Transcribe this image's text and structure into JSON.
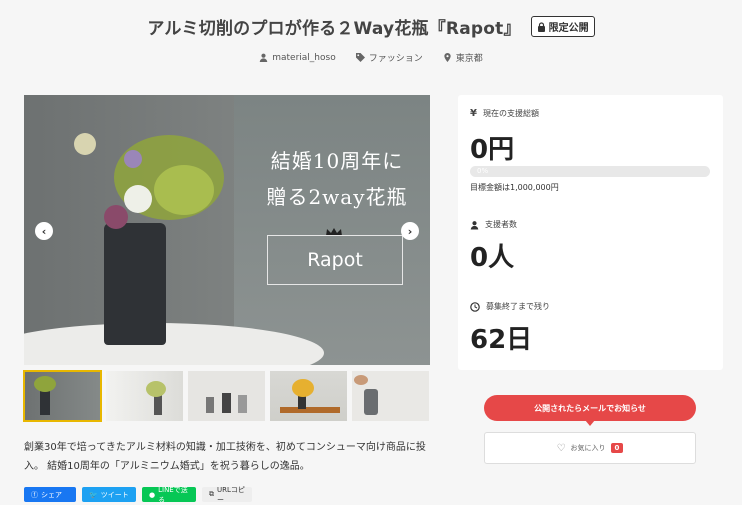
{
  "header": {
    "title": "アルミ切削のプロが作る２Way花瓶『Rapot』",
    "badge": "限定公開"
  },
  "meta": {
    "author": "material_hoso",
    "category": "ファッション",
    "location": "東京都"
  },
  "hero": {
    "line1": "結婚10周年に",
    "line2": "贈る2way花瓶",
    "logo": "Rapot"
  },
  "stats": {
    "total_label": "現在の支援総額",
    "total_value": "0円",
    "progress_percent": 0,
    "progress_label": "0%",
    "goal_text": "目標金額は1,000,000円",
    "backers_label": "支援者数",
    "backers_value": "0人",
    "remaining_label": "募集終了まで残り",
    "remaining_value": "62日"
  },
  "description": "創業30年で培ってきたアルミ材料の知識・加工技術を、初めてコンシューマ向け商品に投入。 結婚10周年の「アルミニウム婚式」を祝う暮らしの逸品。",
  "share": {
    "facebook": "シェア",
    "twitter": "ツイート",
    "line": "LINEで送る",
    "url": "URLコピー"
  },
  "actions": {
    "notify": "公開されたらメールでお知らせ",
    "favorite": "お気に入り",
    "favorite_count": "0"
  },
  "colors": {
    "accent": "#e64848",
    "thumb_active": "#e8b700"
  }
}
